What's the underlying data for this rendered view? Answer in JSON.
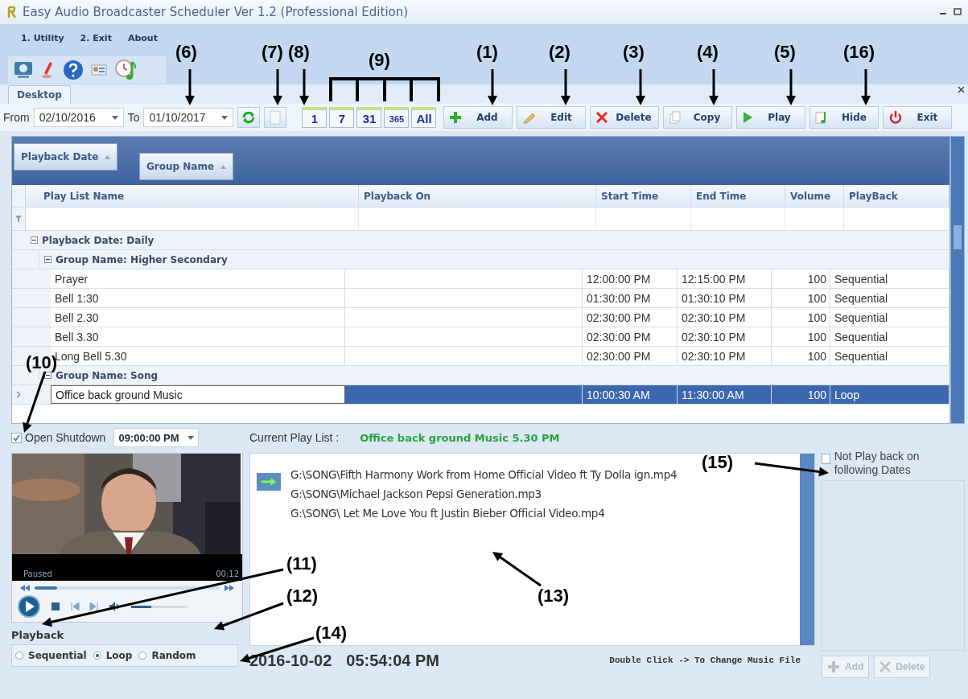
{
  "window": {
    "title": "Easy Audio Broadcaster Scheduler Ver 1.2 (Professional Edition)"
  },
  "menu": [
    "1. Utility",
    "2. Exit",
    "About"
  ],
  "toolbar_icons": [
    {
      "kind": "screen"
    },
    {
      "kind": "pen"
    },
    {
      "kind": "help"
    },
    {
      "kind": "card"
    },
    {
      "kind": "clock-music"
    }
  ],
  "tabs": [
    {
      "label": "Desktop",
      "selected": true
    }
  ],
  "filter": {
    "from_label": "From",
    "from_value": "02/10/2016",
    "to_label": "To",
    "to_value": "01/10/2017"
  },
  "range_buttons": [
    "1",
    "7",
    "31",
    "365",
    "All"
  ],
  "actions": [
    {
      "kind": "add",
      "label": "Add"
    },
    {
      "kind": "edit",
      "label": "Edit"
    },
    {
      "kind": "delete",
      "label": "Delete"
    },
    {
      "kind": "copy",
      "label": "Copy"
    },
    {
      "kind": "play",
      "label": "Play"
    },
    {
      "kind": "hide",
      "label": "Hide"
    },
    {
      "kind": "exit",
      "label": "Exit"
    }
  ],
  "grid": {
    "group_chips": [
      "Playback Date",
      "Group Name"
    ],
    "columns": [
      "Play List Name",
      "Playback On",
      "Start Time",
      "End Time",
      "Volume",
      "PlayBack"
    ],
    "groups": [
      {
        "label": "Playback Date: Daily",
        "expanded": true,
        "children": [
          {
            "label": "Group Name: Higher Secondary",
            "expanded": true,
            "rows": [
              {
                "name": "Prayer",
                "start": "12:00:00 PM",
                "end": "12:15:00 PM",
                "volume": "100",
                "mode": "Sequential",
                "selected": false
              },
              {
                "name": "Bell 1:30",
                "start": "01:30:00 PM",
                "end": "01:30:10 PM",
                "volume": "100",
                "mode": "Sequential",
                "selected": false
              },
              {
                "name": "Bell 2.30",
                "start": "02:30:00 PM",
                "end": "02:30:10 PM",
                "volume": "100",
                "mode": "Sequential",
                "selected": false
              },
              {
                "name": "Bell 3.30",
                "start": "02:30:00 PM",
                "end": "02:30:10 PM",
                "volume": "100",
                "mode": "Sequential",
                "selected": false
              },
              {
                "name": "Long Bell 5.30",
                "start": "02:30:00 PM",
                "end": "02:30:10 PM",
                "volume": "100",
                "mode": "Sequential",
                "selected": false
              }
            ]
          },
          {
            "label": "Group Name: Song",
            "expanded": true,
            "rows": [
              {
                "name": "Office back ground Music",
                "start": "10:00:30 AM",
                "end": "11:30:00 AM",
                "volume": "100",
                "mode": "Loop",
                "selected": true
              }
            ]
          }
        ]
      }
    ]
  },
  "shutdown": {
    "label": "Open Shutdown",
    "checked": true,
    "time": "09:00:00 PM"
  },
  "current_playlist": {
    "label": "Current Play List :",
    "value": "Office back ground Music 5.30 PM"
  },
  "player": {
    "status": "Paused",
    "time": "00:12",
    "seek": {
      "level": 0.12
    },
    "volume": {
      "level": 0.35
    }
  },
  "files": [
    "G:\\SONG\\Fifth Harmony Work from Home Official Video ft Ty Dolla ign.mp4",
    "G:\\SONG\\Michael Jackson Pepsi Generation.mp3",
    "G:\\SONG\\ Let Me Love You ft Justin Bieber Official Video.mp4"
  ],
  "playback": {
    "label": "Playback",
    "options": [
      {
        "label": "Sequential",
        "selected": false
      },
      {
        "label": "Loop",
        "selected": true
      },
      {
        "label": "Random",
        "selected": false
      }
    ]
  },
  "clock": {
    "date": "2016-10-02",
    "time": "05:54:04 PM"
  },
  "hint": "Double Click -> To Change Music File",
  "exclusion": {
    "label": "Not Play back on following Dates",
    "checked": false,
    "buttons": [
      {
        "kind": "add",
        "label": "Add",
        "disabled": true
      },
      {
        "kind": "delete",
        "label": "Delete",
        "disabled": true
      }
    ]
  },
  "callouts": [
    {
      "label": "(6)"
    },
    {
      "label": "(7)"
    },
    {
      "label": "(8)"
    },
    {
      "label": "(9)"
    },
    {
      "label": "(1)"
    },
    {
      "label": "(2)"
    },
    {
      "label": "(3)"
    },
    {
      "label": "(4)"
    },
    {
      "label": "(5)"
    },
    {
      "label": "(16)"
    },
    {
      "label": "(10)"
    },
    {
      "label": "(15)"
    },
    {
      "label": "(11)"
    },
    {
      "label": "(12)"
    },
    {
      "label": "(13)"
    },
    {
      "label": "(14)"
    }
  ]
}
